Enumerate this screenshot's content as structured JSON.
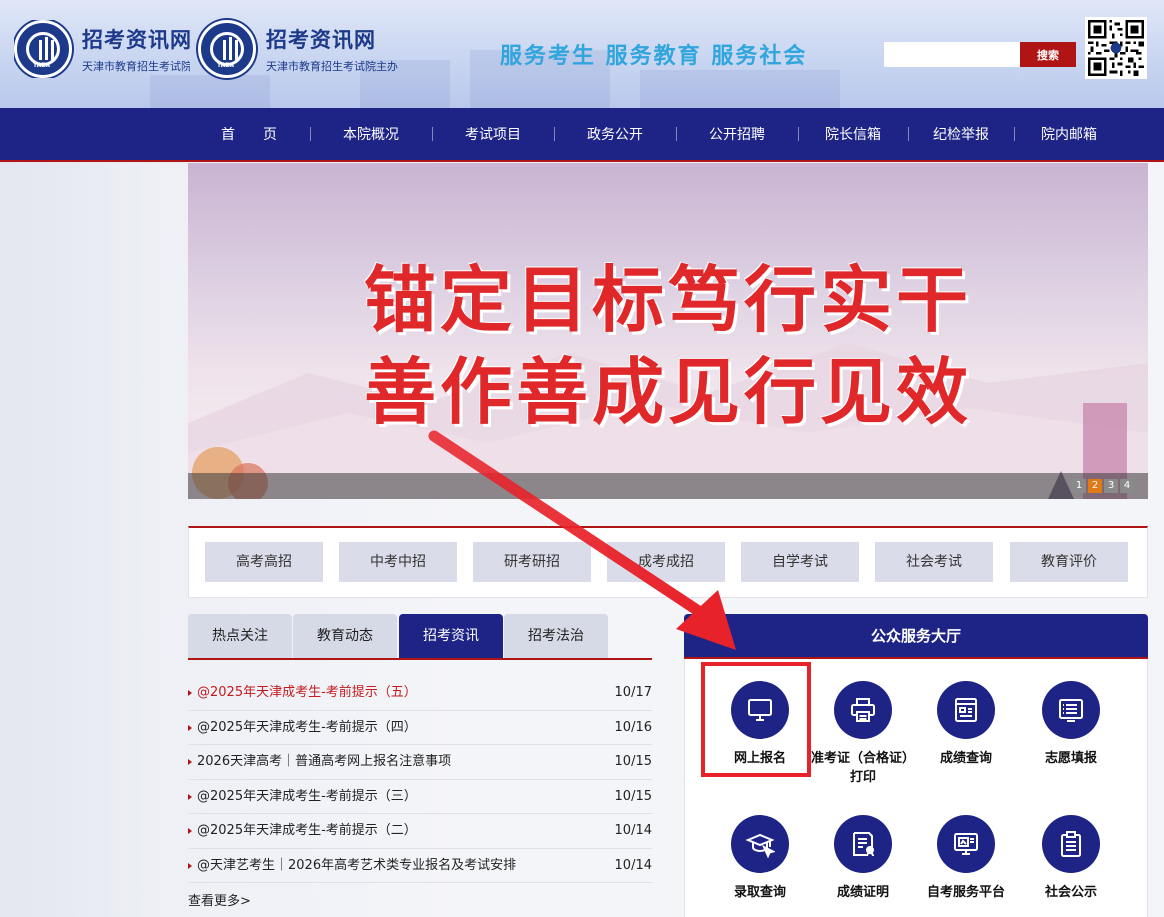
{
  "header": {
    "logo_title": "招考资讯网",
    "logo_sub": "天津市教育招生考试院主办",
    "logo_badge": "TAEA",
    "slogan": "服务考生  服务教育  服务社会",
    "search_placeholder": "",
    "search_button": "搜索"
  },
  "nav": {
    "items": [
      "首　　页",
      "本院概况",
      "考试项目",
      "政务公开",
      "公开招聘",
      "院长信箱",
      "纪检举报",
      "院内邮箱"
    ]
  },
  "banner": {
    "line1": "锚定目标笃行实干",
    "line2": "善作善成见行见效",
    "dots": [
      "1",
      "2",
      "3",
      "4"
    ],
    "active_dot": "2"
  },
  "categories": [
    "高考高招",
    "中考中招",
    "研考研招",
    "成考成招",
    "自学考试",
    "社会考试",
    "教育评价"
  ],
  "tabs": {
    "items": [
      "热点关注",
      "教育动态",
      "招考资讯",
      "招考法治"
    ],
    "active": "招考资讯"
  },
  "news": [
    {
      "title": "@2025年天津成考生-考前提示（五）",
      "date": "10/17"
    },
    {
      "title": "@2025年天津成考生-考前提示（四）",
      "date": "10/16"
    },
    {
      "title": "2026天津高考｜普通高考网上报名注意事项",
      "date": "10/15"
    },
    {
      "title": "@2025年天津成考生-考前提示（三）",
      "date": "10/15"
    },
    {
      "title": "@2025年天津成考生-考前提示（二）",
      "date": "10/14"
    },
    {
      "title": "@天津艺考生｜2026年高考艺术类专业报名及考试安排",
      "date": "10/14"
    }
  ],
  "more_label": "查看更多>",
  "service": {
    "title": "公众服务大厅",
    "items": [
      {
        "label": "网上报名",
        "icon": "monitor-icon"
      },
      {
        "label": "准考证（合格证）打印",
        "icon": "printer-icon"
      },
      {
        "label": "成绩查询",
        "icon": "score-query-icon"
      },
      {
        "label": "志愿填报",
        "icon": "list-board-icon"
      },
      {
        "label": "录取查询",
        "icon": "graduation-cap-icon"
      },
      {
        "label": "成绩证明",
        "icon": "certificate-icon"
      },
      {
        "label": "自考服务平台",
        "icon": "self-exam-platform-icon"
      },
      {
        "label": "社会公示",
        "icon": "clipboard-icon"
      }
    ]
  },
  "colors": {
    "nav_blue": "#1e2486",
    "accent_red": "#b01414",
    "slogan_blue": "#31a6dc",
    "banner_text_red": "#e0282a",
    "annotation_red": "#e8222a"
  }
}
